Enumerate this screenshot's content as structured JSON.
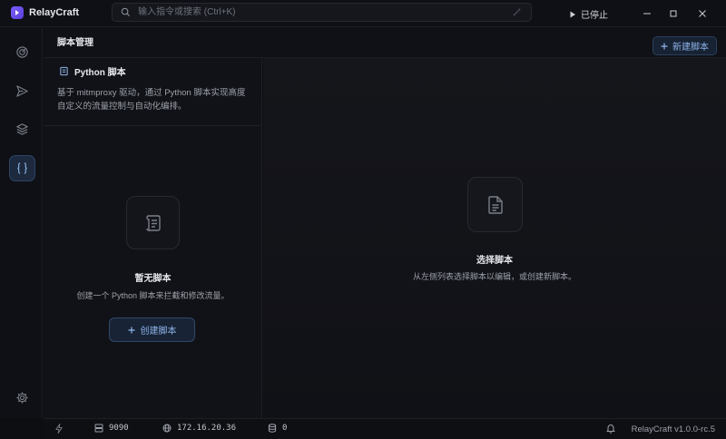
{
  "app": {
    "title": "RelayCraft"
  },
  "search": {
    "placeholder": "输入指令或搜索 (Ctrl+K)"
  },
  "proxy": {
    "status_label": "已停止"
  },
  "header": {
    "title": "脚本管理",
    "new_button": "新建脚本"
  },
  "info": {
    "title": "Python 脚本",
    "description": "基于 mitmproxy 驱动，通过 Python 脚本实现高度自定义的流量控制与自动化编排。"
  },
  "empty": {
    "title": "暂无脚本",
    "description": "创建一个 Python 脚本来拦截和修改流量。",
    "create_button": "创建脚本"
  },
  "detail": {
    "title": "选择脚本",
    "description": "从左侧列表选择脚本以编辑，或创建新脚本。"
  },
  "status": {
    "port": "9090",
    "ip": "172.16.20.36",
    "count": "0",
    "version": "RelayCraft v1.0.0-rc.5"
  },
  "icons": {
    "sidebar": [
      "gauge-icon",
      "send-icon",
      "layers-icon",
      "braces-icon",
      "gear-icon"
    ],
    "active_sidebar": "braces-icon"
  },
  "colors": {
    "accent": "#8fb4ea",
    "brand": "#6b4ff0",
    "background": "#0d0e12"
  }
}
